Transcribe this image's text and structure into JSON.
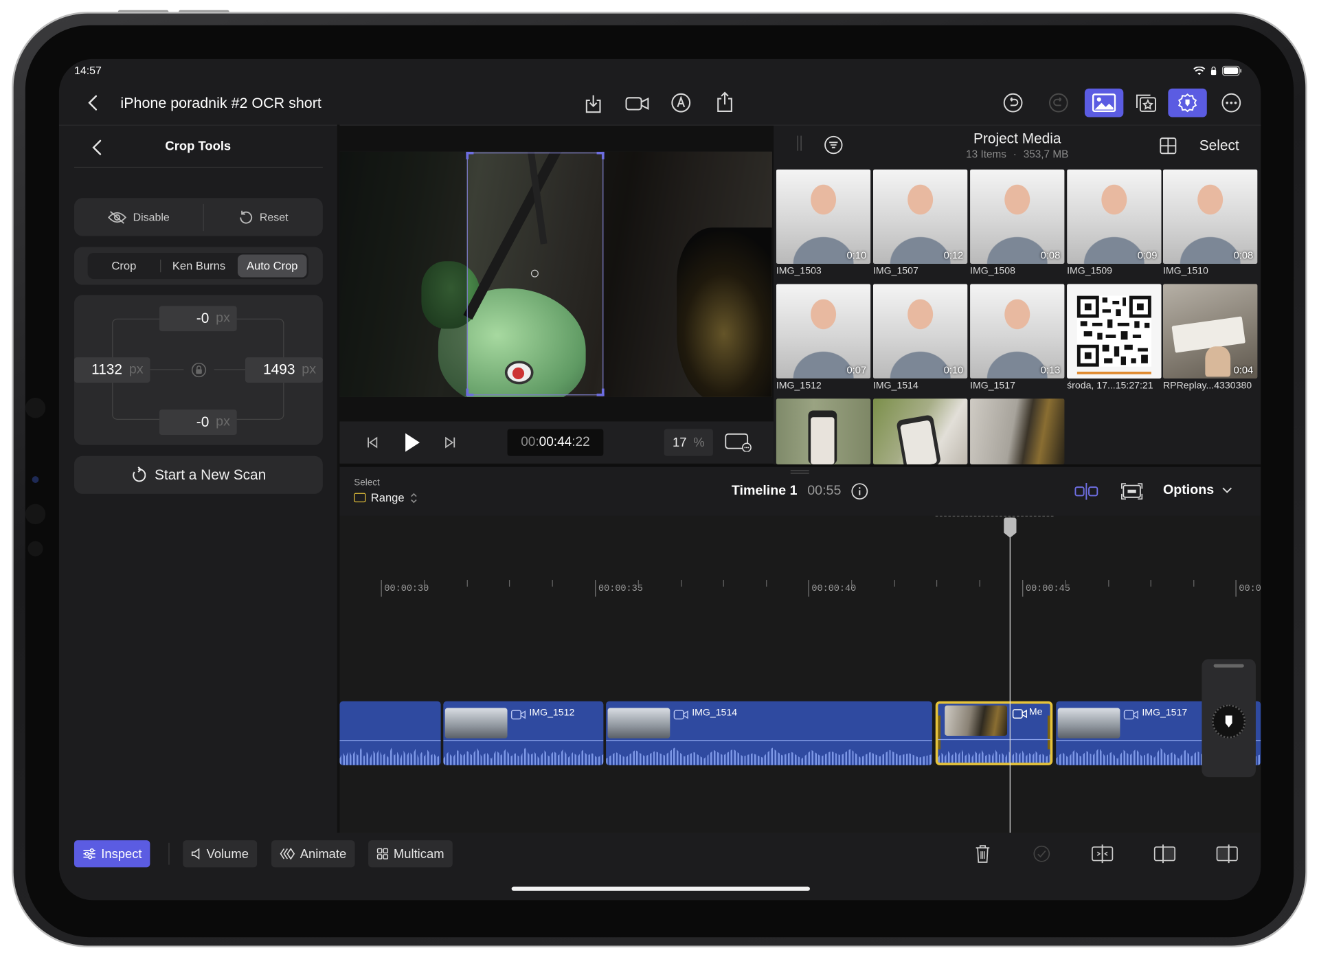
{
  "status_bar": {
    "time": "14:57"
  },
  "header": {
    "title": "iPhone poradnik #2 OCR short"
  },
  "crop_tools": {
    "title": "Crop Tools",
    "disable_label": "Disable",
    "reset_label": "Reset",
    "segments": [
      "Crop",
      "Ken Burns",
      "Auto Crop"
    ],
    "selected_segment": "Auto Crop",
    "top_value": "-0",
    "bottom_value": "-0",
    "left_value": "1132",
    "right_value": "1493",
    "unit": "px",
    "new_scan_label": "Start a New Scan"
  },
  "player": {
    "timecode_prefix": "00:",
    "timecode_main": "00:44",
    "timecode_frames": ":22",
    "zoom_value": "17",
    "zoom_unit": "%"
  },
  "media": {
    "title": "Project Media",
    "items_count": "13 Items",
    "separator": "·",
    "size": "353,7 MB",
    "select_label": "Select",
    "items": [
      {
        "name": "IMG_1503",
        "duration": "0:10"
      },
      {
        "name": "IMG_1507",
        "duration": "0:12"
      },
      {
        "name": "IMG_1508",
        "duration": "0:08"
      },
      {
        "name": "IMG_1509",
        "duration": "0:09"
      },
      {
        "name": "IMG_1510",
        "duration": "0:08"
      },
      {
        "name": "IMG_1512",
        "duration": "0:07"
      },
      {
        "name": "IMG_1514",
        "duration": "0:10"
      },
      {
        "name": "IMG_1517",
        "duration": "0:13"
      },
      {
        "name": "środa, 17...15:27:21",
        "duration": ""
      },
      {
        "name": "RPReplay...4330380",
        "duration": "0:04"
      }
    ]
  },
  "timeline": {
    "select_label": "Select",
    "range_label": "Range",
    "name": "Timeline 1",
    "duration": "00:55",
    "options_label": "Options",
    "timecodes": [
      "00:00:30",
      "00:00:35",
      "00:00:40",
      "00:00:45",
      "00:0"
    ],
    "clips": [
      "IMG_1512",
      "IMG_1514",
      "Me",
      "IMG_1517"
    ]
  },
  "bottom_bar": {
    "inspect_label": "Inspect",
    "volume_label": "Volume",
    "animate_label": "Animate",
    "multicam_label": "Multicam"
  },
  "colors": {
    "accent": "#5b5ce2",
    "selection": "#e6c33a",
    "clip": "#2f4aa0"
  }
}
